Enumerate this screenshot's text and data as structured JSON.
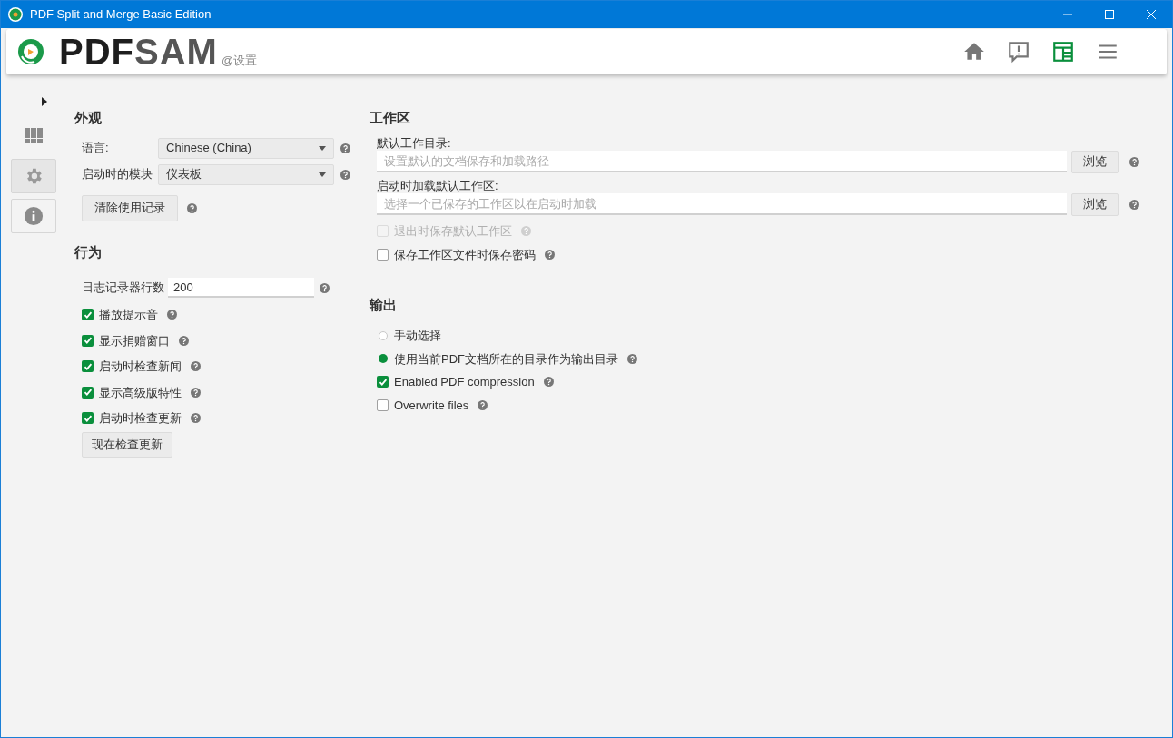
{
  "window": {
    "title": "PDF Split and Merge Basic Edition"
  },
  "header": {
    "logo_dark": "PDF",
    "logo_light": "SAM",
    "subtitle": "@设置",
    "nav": [
      {
        "kind": "home",
        "selected": false
      },
      {
        "kind": "news",
        "selected": false
      },
      {
        "kind": "dashboard",
        "selected": true
      },
      {
        "kind": "menu",
        "selected": false
      }
    ]
  },
  "sidebar": {
    "items": [
      {
        "kind": "grid",
        "selected": false
      },
      {
        "kind": "settings",
        "selected": true
      },
      {
        "kind": "info",
        "selected": false
      }
    ]
  },
  "appearance": {
    "title": "外观",
    "fields": [
      {
        "label": "语言:",
        "value": "Chinese (China)"
      },
      {
        "label": "启动时的模块",
        "value": "仪表板"
      }
    ],
    "button": "清除使用记录"
  },
  "behavior": {
    "title": "行为",
    "log_rows": {
      "label": "日志记录器行数",
      "value": "200"
    },
    "checks": [
      {
        "label": "播放提示音",
        "checked": true
      },
      {
        "label": "显示捐赠窗口",
        "checked": true
      },
      {
        "label": "启动时检查新闻",
        "checked": true
      },
      {
        "label": "显示高级版特性",
        "checked": true
      },
      {
        "label": "启动时检查更新",
        "checked": true
      }
    ],
    "button": "现在检查更新"
  },
  "workspace": {
    "title": "工作区",
    "paths": [
      {
        "label": "默认工作目录:",
        "placeholder": "设置默认的文档保存和加载路径",
        "button": "浏览"
      },
      {
        "label": "启动时加载默认工作区:",
        "placeholder": "选择一个已保存的工作区以在启动时加载",
        "button": "浏览"
      }
    ],
    "checks": [
      {
        "label": "退出时保存默认工作区",
        "checked": false,
        "disabled": true
      },
      {
        "label": "保存工作区文件时保存密码",
        "checked": false,
        "disabled": false
      }
    ]
  },
  "output": {
    "title": "输出",
    "options": [
      {
        "kind": "radio",
        "label": "手动选择",
        "selected": false,
        "help": false
      },
      {
        "kind": "radio",
        "label": "使用当前PDF文档所在的目录作为输出目录",
        "selected": true,
        "help": true
      },
      {
        "kind": "checkbox",
        "label": "Enabled PDF compression",
        "checked": true,
        "help": true
      },
      {
        "kind": "checkbox",
        "label": "Overwrite files",
        "checked": false,
        "help": true
      }
    ]
  }
}
